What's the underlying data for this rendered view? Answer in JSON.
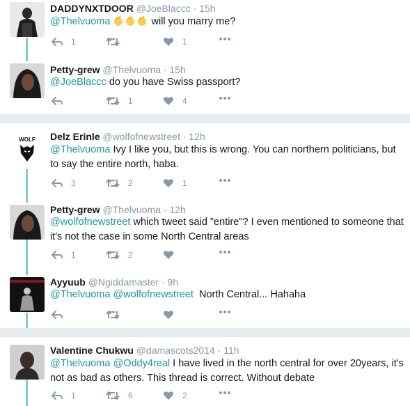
{
  "tweets": [
    {
      "name": "DADDYNXTDOOR",
      "handle": "@JoeBlaccc",
      "time": "15h",
      "mentions": [
        "@Thelvuoma"
      ],
      "text": "will you marry me?",
      "emoji": "clapping-hands-icon",
      "replies": "1",
      "retweets": "",
      "likes": "1"
    },
    {
      "name": "Petty-grew",
      "handle": "@Thelvuoma",
      "time": "15h",
      "mentions": [
        "@JoeBlaccc"
      ],
      "text": "do you have Swiss passport?",
      "replies": "",
      "retweets": "1",
      "likes": "4"
    },
    {
      "name": "Delz Erinle",
      "handle": "@wolfofnewstreet",
      "time": "12h",
      "mentions": [
        "@Thelvuoma"
      ],
      "text": "Ivy I like you, but this is wrong. You can northern politicians, but to say the entire north, haba.",
      "avatar_text": "WOLF",
      "replies": "3",
      "retweets": "2",
      "likes": "1"
    },
    {
      "name": "Petty-grew",
      "handle": "@Thelvuoma",
      "time": "12h",
      "mentions": [
        "@wolfofnewstreet"
      ],
      "text": "which tweet said \"entire\"? I even mentioned to someone that it's not the case in some North Central areas",
      "replies": "1",
      "retweets": "2",
      "likes": ""
    },
    {
      "name": "Ayyuub",
      "handle": "@Ngiddamaster",
      "time": "9h",
      "mentions": [
        "@Thelvuoma",
        "@wolfofnewstreet"
      ],
      "text": "North Central... Hahaha",
      "replies": "",
      "retweets": "",
      "likes": ""
    },
    {
      "name": "Valentine Chukwu",
      "handle": "@damascots2014",
      "time": "11h",
      "mentions": [
        "@Thelvuoma",
        "@Oddy4real"
      ],
      "text": "I have lived in the north central for over 20years, it's not as bad as others. This thread is correct. Without debate",
      "replies": "1",
      "retweets": "6",
      "likes": "2"
    }
  ],
  "separator": "·",
  "colors": {
    "mention": "#1b95a0",
    "muted": "#8899a6",
    "thread_line": "#80cdd0",
    "separator": "#e6ecf0"
  }
}
